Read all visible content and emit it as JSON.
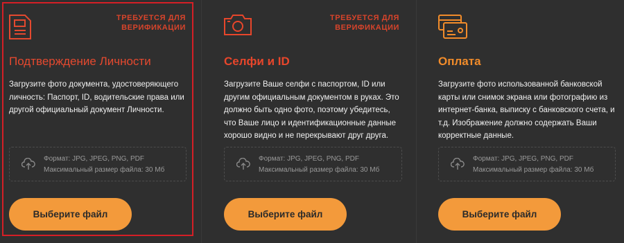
{
  "colors": {
    "background": "#2f2f2f",
    "accent_red": "#e8462b",
    "accent_orange": "#f28c2a",
    "button": "#f39a3b",
    "selected_border": "#d61f26"
  },
  "cards": [
    {
      "badge": "ТРЕБУЕТСЯ ДЛЯ ВЕРИФИКАЦИИ",
      "title": "Подтверждение Личности",
      "description": "Загрузите фото документа, удостоверяющего личность: Паспорт, ID, водительские права или другой официальный документ Личности.",
      "format": "Формат: JPG, JPEG, PNG, PDF",
      "max_size": "Максимальный размер файла: 30 Мб",
      "button": "Выберите файл",
      "icon": "document-icon",
      "selected": true
    },
    {
      "badge": "ТРЕБУЕТСЯ ДЛЯ ВЕРИФИКАЦИИ",
      "title": "Селфи и ID",
      "description": "Загрузите Ваше селфи с паспортом, ID или другим официальным документом в руках. Это должно быть одно фото, поэтому убедитесь, что Ваше лицо и идентификационные данные хорошо видно и не перекрывают друг друга.",
      "format": "Формат: JPG, JPEG, PNG, PDF",
      "max_size": "Максимальный размер файла: 30 Мб",
      "button": "Выберите файл",
      "icon": "camera-icon",
      "selected": false
    },
    {
      "badge": "",
      "title": "Оплата",
      "description": "Загрузите фото использованной банковской карты или снимок экрана или фотографию из интернет-банка, выписку с банковского счета, и т.д. Изображение должно содержать Ваши корректные данные.",
      "format": "Формат: JPG, JPEG, PNG, PDF",
      "max_size": "Максимальный размер файла: 30 Мб",
      "button": "Выберите файл",
      "icon": "credit-cards-icon",
      "selected": false
    }
  ]
}
